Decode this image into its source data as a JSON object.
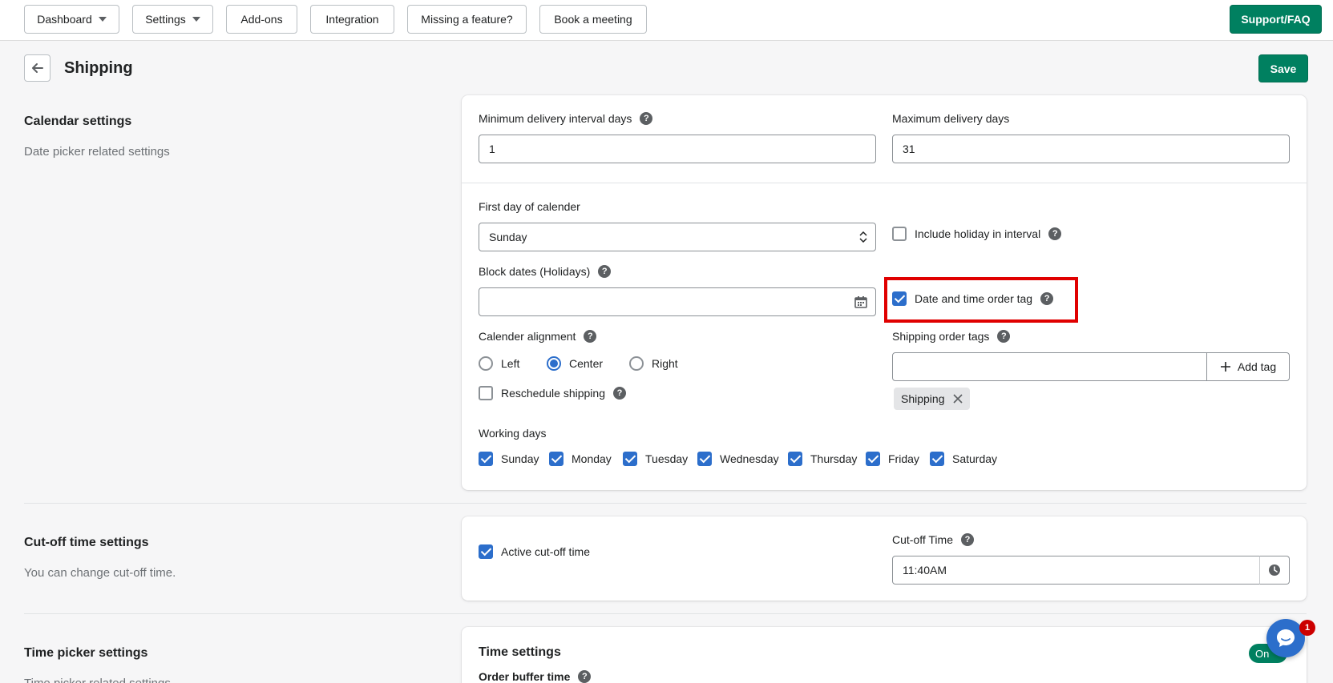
{
  "nav": {
    "dashboard": "Dashboard",
    "settings": "Settings",
    "addons": "Add-ons",
    "integration": "Integration",
    "missing_feature": "Missing a feature?",
    "book_meeting": "Book a meeting",
    "support": "Support/FAQ"
  },
  "header": {
    "title": "Shipping",
    "save": "Save"
  },
  "calendar": {
    "title": "Calendar settings",
    "desc": "Date picker related settings",
    "min_interval_label": "Minimum delivery interval days",
    "min_interval_value": "1",
    "max_days_label": "Maximum delivery days",
    "max_days_value": "31",
    "first_day_label": "First day of calender",
    "first_day_value": "Sunday",
    "include_holiday_label": "Include holiday in interval",
    "block_dates_label": "Block dates (Holidays)",
    "date_time_tag_label": "Date and time order tag",
    "alignment_label": "Calender alignment",
    "alignment_options": [
      "Left",
      "Center",
      "Right"
    ],
    "alignment_selected": "Center",
    "shipping_tags_label": "Shipping order tags",
    "add_tag": "Add tag",
    "tag_chip": "Shipping",
    "reschedule_label": "Reschedule shipping",
    "working_days_label": "Working days",
    "working_days": [
      "Sunday",
      "Monday",
      "Tuesday",
      "Wednesday",
      "Thursday",
      "Friday",
      "Saturday"
    ]
  },
  "cutoff": {
    "title": "Cut-off time settings",
    "desc": "You can change cut-off time.",
    "active_label": "Active cut-off time",
    "time_label": "Cut-off Time",
    "time_value": "11:40AM"
  },
  "timepicker": {
    "title": "Time picker settings",
    "desc": "Time picker related settings",
    "card_title": "Time settings",
    "buffer_label": "Order buffer time",
    "toggle": "On"
  },
  "chat": {
    "badge": "1"
  },
  "colors": {
    "primary": "#008060",
    "checkbox": "#2c6ecb",
    "highlight": "#e00000"
  }
}
